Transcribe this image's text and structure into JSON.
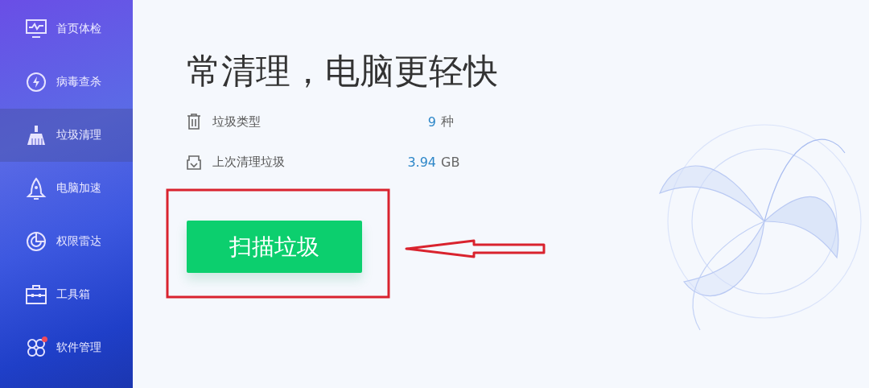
{
  "sidebar": {
    "items": [
      {
        "label": "首页体检",
        "selected": false,
        "notification": false
      },
      {
        "label": "病毒查杀",
        "selected": false,
        "notification": false
      },
      {
        "label": "垃圾清理",
        "selected": true,
        "notification": false
      },
      {
        "label": "电脑加速",
        "selected": false,
        "notification": false
      },
      {
        "label": "权限雷达",
        "selected": false,
        "notification": false
      },
      {
        "label": "工具箱",
        "selected": false,
        "notification": false
      },
      {
        "label": "软件管理",
        "selected": false,
        "notification": true
      }
    ]
  },
  "main": {
    "title": "常清理，电脑更轻快",
    "stats": [
      {
        "label": "垃圾类型",
        "value": "9",
        "unit": "种"
      },
      {
        "label": "上次清理垃圾",
        "value": "3.94",
        "unit": "GB"
      }
    ],
    "button": "扫描垃圾"
  }
}
